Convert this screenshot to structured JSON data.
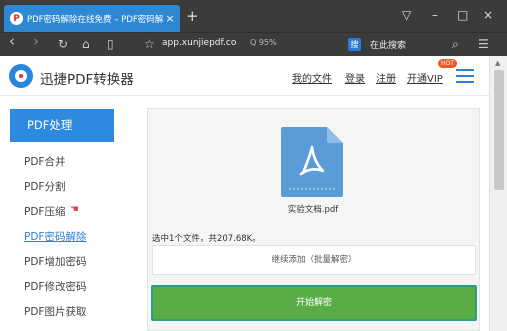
{
  "browser": {
    "tab": {
      "favicon": "P",
      "title": "PDF密码解除在线免费 – PDF密码解",
      "close": "×"
    },
    "new_tab": "+",
    "window_controls": {
      "pin": "▽",
      "minimize": "–",
      "maximize": "□",
      "close": "×"
    },
    "nav": {
      "back": "‹",
      "forward": "›",
      "reload": "↻",
      "home": "⌂",
      "reader": "▯"
    },
    "star": "☆",
    "url": "app.xunjiepdf.co",
    "zoom": "Q 95%",
    "search_engine_icon": "搜",
    "search_placeholder": "在此搜索",
    "search_icon": "⌕",
    "menu_icon": "☰"
  },
  "header": {
    "brand": "迅捷PDF转换器",
    "links": {
      "my_files": "我的文件",
      "login": "登录",
      "register": "注册",
      "vip": "开通VIP"
    },
    "vip_badge": "HOT"
  },
  "sidebar": {
    "heading": "PDF处理",
    "items": [
      {
        "label": "PDF合并"
      },
      {
        "label": "PDF分割"
      },
      {
        "label": "PDF压缩"
      },
      {
        "label": "PDF密码解除",
        "active": true
      },
      {
        "label": "PDF增加密码"
      },
      {
        "label": "PDF修改密码"
      },
      {
        "label": "PDF图片获取"
      }
    ]
  },
  "main": {
    "file_name": "实验文档.pdf",
    "file_info": "选中1个文件，共207.68K。",
    "add_more_label": "继续添加（批量解密）",
    "start_label": "开始解密"
  },
  "colors": {
    "accent": "#2d8ae0",
    "start_button": "#5aad45",
    "file_icon": "#5b9bd8"
  }
}
